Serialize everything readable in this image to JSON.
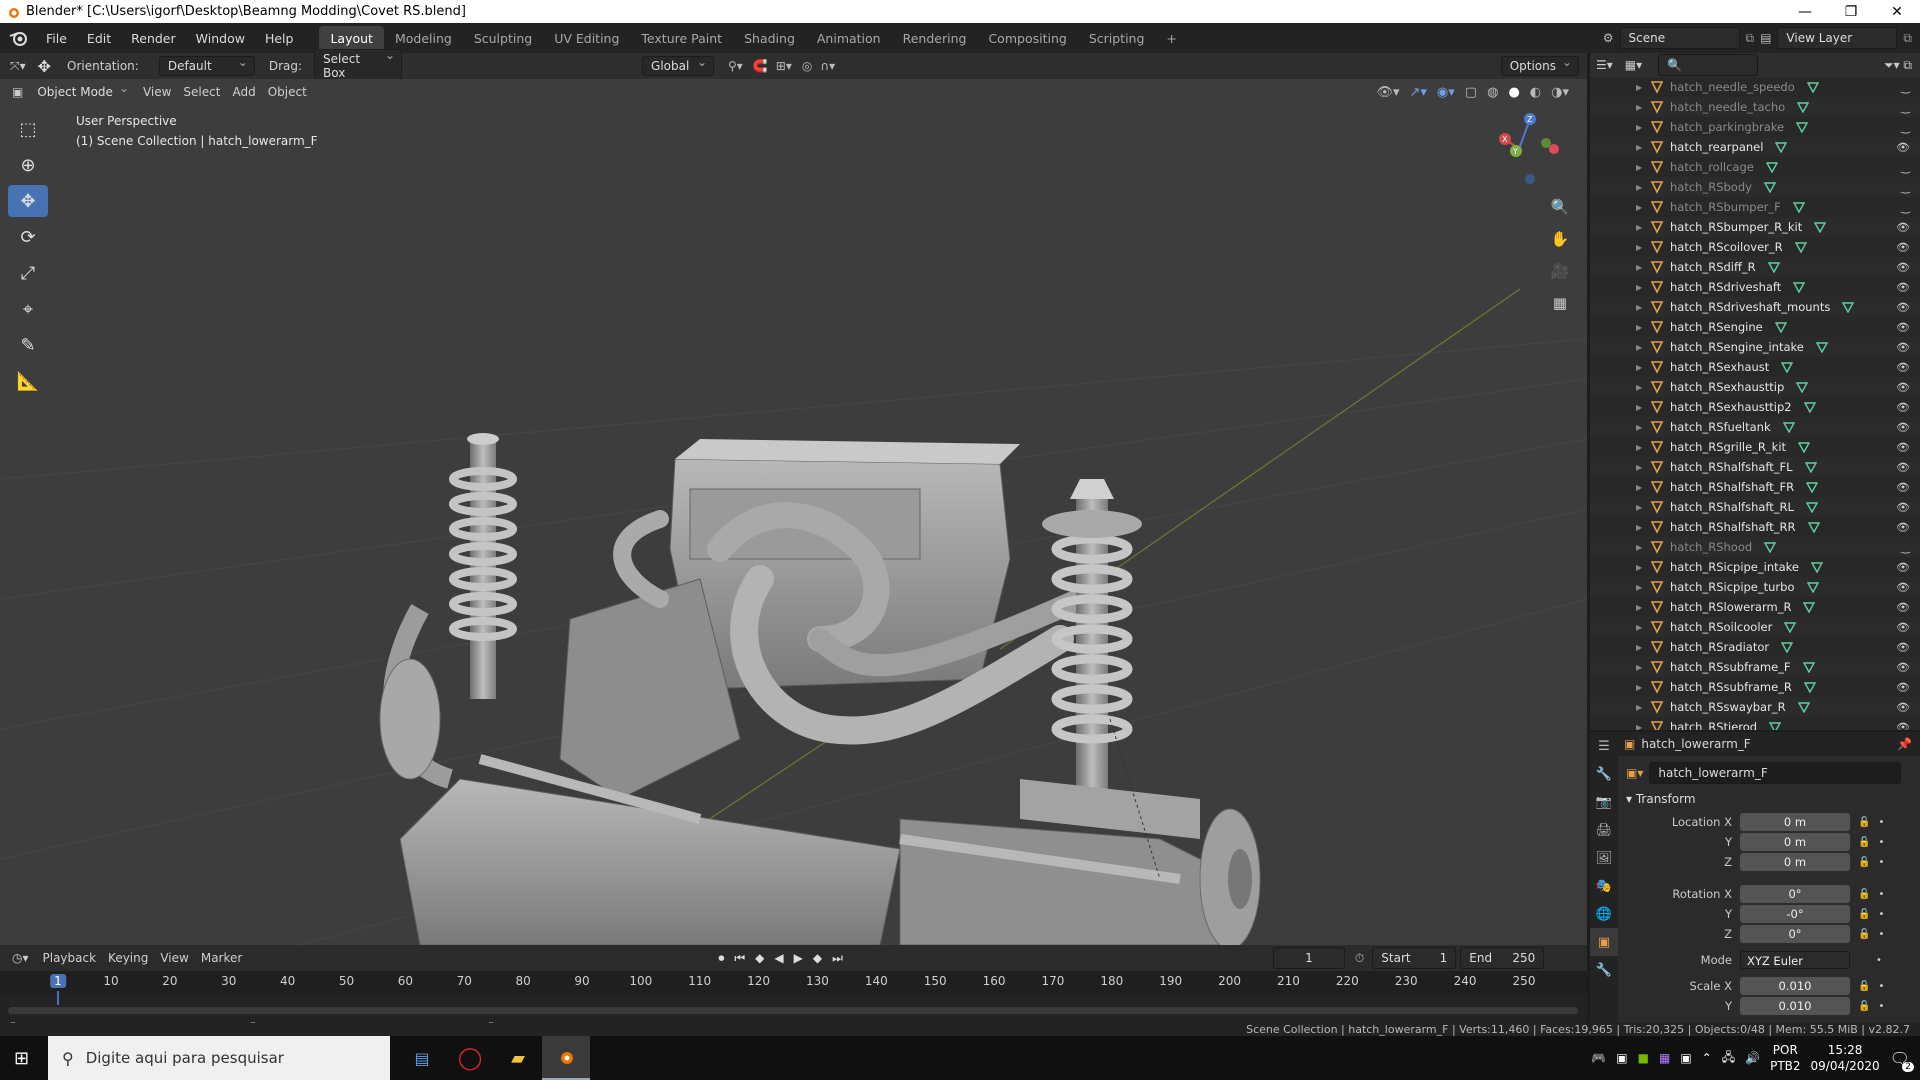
{
  "window": {
    "title": "Blender* [C:\\Users\\igorf\\Desktop\\Beamng Modding\\Covet RS.blend]"
  },
  "menu": [
    "File",
    "Edit",
    "Render",
    "Window",
    "Help"
  ],
  "workspaces": [
    "Layout",
    "Modeling",
    "Sculpting",
    "UV Editing",
    "Texture Paint",
    "Shading",
    "Animation",
    "Rendering",
    "Compositing",
    "Scripting"
  ],
  "scene": {
    "label": "Scene",
    "view_layer": "View Layer"
  },
  "toolbar_header": {
    "orientation_label": "Orientation:",
    "orientation_value": "Default",
    "drag_label": "Drag:",
    "drag_value": "Select Box",
    "transform_space": "Global",
    "options": "Options"
  },
  "viewport_header": {
    "mode": "Object Mode",
    "items": [
      "View",
      "Select",
      "Add",
      "Object"
    ]
  },
  "viewport_info": {
    "line1": "User Perspective",
    "line2": "(1) Scene Collection | hatch_lowerarm_F"
  },
  "timeline": {
    "menus": [
      "Playback",
      "Keying",
      "View",
      "Marker"
    ],
    "current_frame": "1",
    "start_label": "Start",
    "start": "1",
    "end_label": "End",
    "end": "250",
    "ticks": [
      "1",
      "10",
      "20",
      "30",
      "40",
      "50",
      "60",
      "70",
      "80",
      "90",
      "100",
      "110",
      "120",
      "130",
      "140",
      "150",
      "160",
      "170",
      "180",
      "190",
      "200",
      "210",
      "220",
      "230",
      "240",
      "250"
    ]
  },
  "status": "Scene Collection | hatch_lowerarm_F | Verts:11,460 | Faces:19,965 | Tris:20,325 | Objects:0/48 | Mem: 55.5 MiB | v2.82.7",
  "outliner": {
    "items": [
      {
        "name": "hatch_needle_speedo",
        "dim": true
      },
      {
        "name": "hatch_needle_tacho",
        "dim": true
      },
      {
        "name": "hatch_parkingbrake",
        "dim": true
      },
      {
        "name": "hatch_rearpanel",
        "dim": false
      },
      {
        "name": "hatch_rollcage",
        "dim": true
      },
      {
        "name": "hatch_RSbody",
        "dim": true
      },
      {
        "name": "hatch_RSbumper_F",
        "dim": true
      },
      {
        "name": "hatch_RSbumper_R_kit",
        "dim": false
      },
      {
        "name": "hatch_RScoilover_R",
        "dim": false
      },
      {
        "name": "hatch_RSdiff_R",
        "dim": false
      },
      {
        "name": "hatch_RSdriveshaft",
        "dim": false
      },
      {
        "name": "hatch_RSdriveshaft_mounts",
        "dim": false
      },
      {
        "name": "hatch_RSengine",
        "dim": false
      },
      {
        "name": "hatch_RSengine_intake",
        "dim": false
      },
      {
        "name": "hatch_RSexhaust",
        "dim": false
      },
      {
        "name": "hatch_RSexhausttip",
        "dim": false
      },
      {
        "name": "hatch_RSexhausttip2",
        "dim": false
      },
      {
        "name": "hatch_RSfueltank",
        "dim": false
      },
      {
        "name": "hatch_RSgrille_R_kit",
        "dim": false
      },
      {
        "name": "hatch_RShalfshaft_FL",
        "dim": false
      },
      {
        "name": "hatch_RShalfshaft_FR",
        "dim": false
      },
      {
        "name": "hatch_RShalfshaft_RL",
        "dim": false
      },
      {
        "name": "hatch_RShalfshaft_RR",
        "dim": false
      },
      {
        "name": "hatch_RShood",
        "dim": true
      },
      {
        "name": "hatch_RSicpipe_intake",
        "dim": false
      },
      {
        "name": "hatch_RSicpipe_turbo",
        "dim": false
      },
      {
        "name": "hatch_RSlowerarm_R",
        "dim": false
      },
      {
        "name": "hatch_RSoilcooler",
        "dim": false
      },
      {
        "name": "hatch_RSradiator",
        "dim": false
      },
      {
        "name": "hatch_RSsubframe_F",
        "dim": false
      },
      {
        "name": "hatch_RSsubframe_R",
        "dim": false
      },
      {
        "name": "hatch_RSswaybar_R",
        "dim": false
      },
      {
        "name": "hatch_RStierod",
        "dim": false
      }
    ]
  },
  "properties": {
    "object_name": "hatch_lowerarm_F",
    "data_name": "hatch_lowerarm_F",
    "panel": "Transform",
    "location_x_label": "Location X",
    "location_x": "0 m",
    "location_y_label": "Y",
    "location_y": "0 m",
    "location_z_label": "Z",
    "location_z": "0 m",
    "rotation_x_label": "Rotation X",
    "rotation_x": "0°",
    "rotation_y_label": "Y",
    "rotation_y": "-0°",
    "rotation_z_label": "Z",
    "rotation_z": "0°",
    "mode_label": "Mode",
    "mode": "XYZ Euler",
    "scale_x_label": "Scale X",
    "scale_x": "0.010",
    "scale_y_label": "Y",
    "scale_y": "0.010"
  },
  "taskbar": {
    "search_placeholder": "Digite aqui para pesquisar",
    "lang1": "POR",
    "lang2": "PTB2",
    "time": "15:28",
    "date": "09/04/2020",
    "notification_count": "2"
  },
  "colors": {
    "accent": "#4772b3",
    "outliner_icon": "#e6a04c",
    "mesh_icon": "#5fd1a0"
  }
}
